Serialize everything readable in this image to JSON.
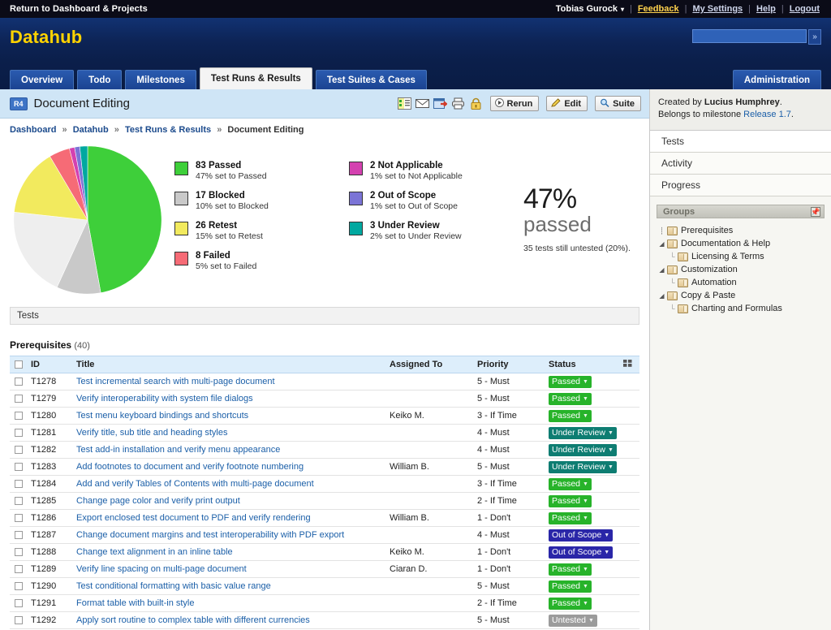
{
  "topbar": {
    "return_link": "Return to Dashboard & Projects",
    "user": "Tobias Gurock",
    "caret": "▾",
    "feedback": "Feedback",
    "my_settings": "My Settings",
    "help": "Help",
    "logout": "Logout"
  },
  "header": {
    "brand": "Datahub",
    "search_value": "",
    "search_placeholder": "",
    "search_go": "»"
  },
  "tabs": [
    {
      "label": "Overview",
      "active": false
    },
    {
      "label": "Todo",
      "active": false
    },
    {
      "label": "Milestones",
      "active": false
    },
    {
      "label": "Test Runs & Results",
      "active": true
    },
    {
      "label": "Test Suites & Cases",
      "active": false
    }
  ],
  "admin_tab": "Administration",
  "titlebar": {
    "badge": "R4",
    "title": "Document Editing",
    "icons": [
      "view-toggle-icon",
      "email-icon",
      "export-icon",
      "print-icon",
      "lock-icon"
    ],
    "buttons": [
      {
        "label": "Rerun",
        "icon": "play-icon"
      },
      {
        "label": "Edit",
        "icon": "pencil-icon"
      },
      {
        "label": "Suite",
        "icon": "magnifier-icon"
      }
    ]
  },
  "breadcrumb": {
    "items": [
      "Dashboard",
      "Datahub",
      "Test Runs & Results"
    ],
    "current": "Document Editing",
    "separator": "»"
  },
  "chart_data": {
    "type": "pie",
    "title": "",
    "legend_position": "right",
    "categories": [
      "Passed",
      "Blocked",
      "Retest",
      "Failed",
      "Not Applicable",
      "Out of Scope",
      "Under Review",
      "Untested"
    ],
    "values": [
      83,
      17,
      26,
      8,
      2,
      2,
      3,
      35
    ],
    "percents": [
      47,
      10,
      15,
      5,
      1,
      1,
      2,
      20
    ],
    "colors": [
      "#3ecf3a",
      "#c9c9c9",
      "#f2ea5e",
      "#f66b76",
      "#d441b0",
      "#7b74d6",
      "#00a8a0",
      "#eeeeee"
    ],
    "summary_percent": "47%",
    "summary_word": "passed",
    "summary_note": "35 tests still untested (20%)."
  },
  "legend": {
    "left": [
      {
        "count_label": "83 Passed",
        "sub": "47% set to Passed",
        "color": "#3ecf3a"
      },
      {
        "count_label": "17 Blocked",
        "sub": "10% set to Blocked",
        "color": "#c9c9c9"
      },
      {
        "count_label": "26 Retest",
        "sub": "15% set to Retest",
        "color": "#f2ea5e"
      },
      {
        "count_label": "8 Failed",
        "sub": "5% set to Failed",
        "color": "#f66b76"
      }
    ],
    "right": [
      {
        "count_label": "2 Not Applicable",
        "sub": "1% set to Not Applicable",
        "color": "#d441b0"
      },
      {
        "count_label": "2 Out of Scope",
        "sub": "1% set to Out of Scope",
        "color": "#7b74d6"
      },
      {
        "count_label": "3 Under Review",
        "sub": "2% set to Under Review",
        "color": "#00a8a0"
      }
    ]
  },
  "tests_section_label": "Tests",
  "group": {
    "name": "Prerequisites",
    "count": "(40)"
  },
  "table": {
    "columns": [
      "ID",
      "Title",
      "Assigned To",
      "Priority",
      "Status"
    ],
    "rows": [
      {
        "id": "T1278",
        "title": "Test incremental search with multi-page document",
        "assigned": "",
        "priority": "5 - Must",
        "status": "Passed",
        "status_class": "b-passed"
      },
      {
        "id": "T1279",
        "title": "Verify interoperability with system file dialogs",
        "assigned": "",
        "priority": "5 - Must",
        "status": "Passed",
        "status_class": "b-passed"
      },
      {
        "id": "T1280",
        "title": "Test menu keyboard bindings and shortcuts",
        "assigned": "Keiko M.",
        "priority": "3 - If Time",
        "status": "Passed",
        "status_class": "b-passed"
      },
      {
        "id": "T1281",
        "title": "Verify title, sub title and heading styles",
        "assigned": "",
        "priority": "4 - Must",
        "status": "Under Review",
        "status_class": "b-review"
      },
      {
        "id": "T1282",
        "title": "Test add-in installation and verify menu appearance",
        "assigned": "",
        "priority": "4 - Must",
        "status": "Under Review",
        "status_class": "b-review"
      },
      {
        "id": "T1283",
        "title": "Add footnotes to document and verify footnote numbering",
        "assigned": "William B.",
        "priority": "5 - Must",
        "status": "Under Review",
        "status_class": "b-review"
      },
      {
        "id": "T1284",
        "title": "Add and verify Tables of Contents with multi-page document",
        "assigned": "",
        "priority": "3 - If Time",
        "status": "Passed",
        "status_class": "b-passed"
      },
      {
        "id": "T1285",
        "title": "Change page color and verify print output",
        "assigned": "",
        "priority": "2 - If Time",
        "status": "Passed",
        "status_class": "b-passed"
      },
      {
        "id": "T1286",
        "title": "Export enclosed test document to PDF and verify rendering",
        "assigned": "William B.",
        "priority": "1 - Don't",
        "status": "Passed",
        "status_class": "b-passed"
      },
      {
        "id": "T1287",
        "title": "Change document margins and test interoperability with PDF export",
        "assigned": "",
        "priority": "4 - Must",
        "status": "Out of Scope",
        "status_class": "b-scope"
      },
      {
        "id": "T1288",
        "title": "Change text alignment in an inline table",
        "assigned": "Keiko M.",
        "priority": "1 - Don't",
        "status": "Out of Scope",
        "status_class": "b-scope"
      },
      {
        "id": "T1289",
        "title": "Verify line spacing on multi-page document",
        "assigned": "Ciaran D.",
        "priority": "1 - Don't",
        "status": "Passed",
        "status_class": "b-passed"
      },
      {
        "id": "T1290",
        "title": "Test conditional formatting with basic value range",
        "assigned": "",
        "priority": "5 - Must",
        "status": "Passed",
        "status_class": "b-passed"
      },
      {
        "id": "T1291",
        "title": "Format table with built-in style",
        "assigned": "",
        "priority": "2 - If Time",
        "status": "Passed",
        "status_class": "b-passed"
      },
      {
        "id": "T1292",
        "title": "Apply sort routine to complex table with different currencies",
        "assigned": "",
        "priority": "5 - Must",
        "status": "Untested",
        "status_class": "b-untested"
      }
    ]
  },
  "rail": {
    "created_prefix": "Created by ",
    "created_by": "Lucius Humphrey",
    "created_suffix": ".",
    "milestone_prefix": "Belongs to milestone ",
    "milestone": "Release 1.7",
    "milestone_suffix": ".",
    "sections": [
      "Tests",
      "Activity",
      "Progress"
    ],
    "groups_title": "Groups",
    "groups": [
      {
        "label": "Prerequisites",
        "depth": 0,
        "toggle": "dash"
      },
      {
        "label": "Documentation & Help",
        "depth": 0,
        "toggle": "expanded"
      },
      {
        "label": "Licensing & Terms",
        "depth": 1,
        "toggle": "dash"
      },
      {
        "label": "Customization",
        "depth": 0,
        "toggle": "expanded"
      },
      {
        "label": "Automation",
        "depth": 1,
        "toggle": "dash"
      },
      {
        "label": "Copy & Paste",
        "depth": 0,
        "toggle": "expanded"
      },
      {
        "label": "Charting and Formulas",
        "depth": 1,
        "toggle": "dash"
      }
    ]
  }
}
